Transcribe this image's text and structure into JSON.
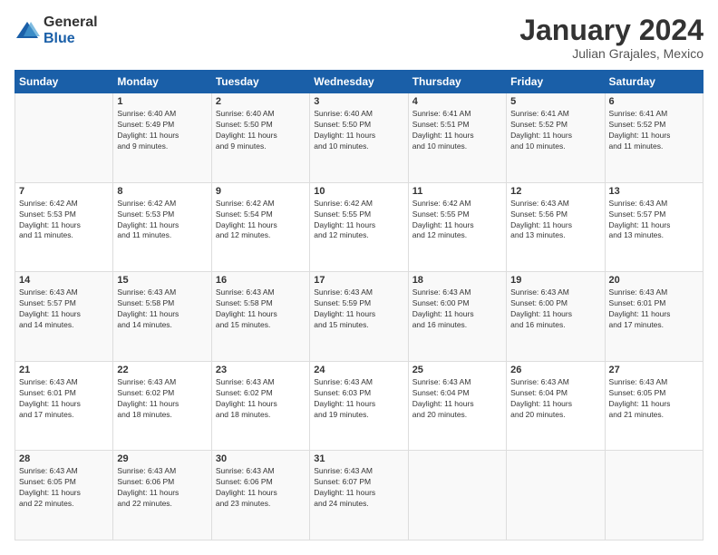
{
  "logo": {
    "general": "General",
    "blue": "Blue"
  },
  "title": "January 2024",
  "subtitle": "Julian Grajales, Mexico",
  "days_of_week": [
    "Sunday",
    "Monday",
    "Tuesday",
    "Wednesday",
    "Thursday",
    "Friday",
    "Saturday"
  ],
  "weeks": [
    [
      {
        "day": "",
        "info": ""
      },
      {
        "day": "1",
        "info": "Sunrise: 6:40 AM\nSunset: 5:49 PM\nDaylight: 11 hours\nand 9 minutes."
      },
      {
        "day": "2",
        "info": "Sunrise: 6:40 AM\nSunset: 5:50 PM\nDaylight: 11 hours\nand 9 minutes."
      },
      {
        "day": "3",
        "info": "Sunrise: 6:40 AM\nSunset: 5:50 PM\nDaylight: 11 hours\nand 10 minutes."
      },
      {
        "day": "4",
        "info": "Sunrise: 6:41 AM\nSunset: 5:51 PM\nDaylight: 11 hours\nand 10 minutes."
      },
      {
        "day": "5",
        "info": "Sunrise: 6:41 AM\nSunset: 5:52 PM\nDaylight: 11 hours\nand 10 minutes."
      },
      {
        "day": "6",
        "info": "Sunrise: 6:41 AM\nSunset: 5:52 PM\nDaylight: 11 hours\nand 11 minutes."
      }
    ],
    [
      {
        "day": "7",
        "info": "Sunrise: 6:42 AM\nSunset: 5:53 PM\nDaylight: 11 hours\nand 11 minutes."
      },
      {
        "day": "8",
        "info": "Sunrise: 6:42 AM\nSunset: 5:53 PM\nDaylight: 11 hours\nand 11 minutes."
      },
      {
        "day": "9",
        "info": "Sunrise: 6:42 AM\nSunset: 5:54 PM\nDaylight: 11 hours\nand 12 minutes."
      },
      {
        "day": "10",
        "info": "Sunrise: 6:42 AM\nSunset: 5:55 PM\nDaylight: 11 hours\nand 12 minutes."
      },
      {
        "day": "11",
        "info": "Sunrise: 6:42 AM\nSunset: 5:55 PM\nDaylight: 11 hours\nand 12 minutes."
      },
      {
        "day": "12",
        "info": "Sunrise: 6:43 AM\nSunset: 5:56 PM\nDaylight: 11 hours\nand 13 minutes."
      },
      {
        "day": "13",
        "info": "Sunrise: 6:43 AM\nSunset: 5:57 PM\nDaylight: 11 hours\nand 13 minutes."
      }
    ],
    [
      {
        "day": "14",
        "info": "Sunrise: 6:43 AM\nSunset: 5:57 PM\nDaylight: 11 hours\nand 14 minutes."
      },
      {
        "day": "15",
        "info": "Sunrise: 6:43 AM\nSunset: 5:58 PM\nDaylight: 11 hours\nand 14 minutes."
      },
      {
        "day": "16",
        "info": "Sunrise: 6:43 AM\nSunset: 5:58 PM\nDaylight: 11 hours\nand 15 minutes."
      },
      {
        "day": "17",
        "info": "Sunrise: 6:43 AM\nSunset: 5:59 PM\nDaylight: 11 hours\nand 15 minutes."
      },
      {
        "day": "18",
        "info": "Sunrise: 6:43 AM\nSunset: 6:00 PM\nDaylight: 11 hours\nand 16 minutes."
      },
      {
        "day": "19",
        "info": "Sunrise: 6:43 AM\nSunset: 6:00 PM\nDaylight: 11 hours\nand 16 minutes."
      },
      {
        "day": "20",
        "info": "Sunrise: 6:43 AM\nSunset: 6:01 PM\nDaylight: 11 hours\nand 17 minutes."
      }
    ],
    [
      {
        "day": "21",
        "info": "Sunrise: 6:43 AM\nSunset: 6:01 PM\nDaylight: 11 hours\nand 17 minutes."
      },
      {
        "day": "22",
        "info": "Sunrise: 6:43 AM\nSunset: 6:02 PM\nDaylight: 11 hours\nand 18 minutes."
      },
      {
        "day": "23",
        "info": "Sunrise: 6:43 AM\nSunset: 6:02 PM\nDaylight: 11 hours\nand 18 minutes."
      },
      {
        "day": "24",
        "info": "Sunrise: 6:43 AM\nSunset: 6:03 PM\nDaylight: 11 hours\nand 19 minutes."
      },
      {
        "day": "25",
        "info": "Sunrise: 6:43 AM\nSunset: 6:04 PM\nDaylight: 11 hours\nand 20 minutes."
      },
      {
        "day": "26",
        "info": "Sunrise: 6:43 AM\nSunset: 6:04 PM\nDaylight: 11 hours\nand 20 minutes."
      },
      {
        "day": "27",
        "info": "Sunrise: 6:43 AM\nSunset: 6:05 PM\nDaylight: 11 hours\nand 21 minutes."
      }
    ],
    [
      {
        "day": "28",
        "info": "Sunrise: 6:43 AM\nSunset: 6:05 PM\nDaylight: 11 hours\nand 22 minutes."
      },
      {
        "day": "29",
        "info": "Sunrise: 6:43 AM\nSunset: 6:06 PM\nDaylight: 11 hours\nand 22 minutes."
      },
      {
        "day": "30",
        "info": "Sunrise: 6:43 AM\nSunset: 6:06 PM\nDaylight: 11 hours\nand 23 minutes."
      },
      {
        "day": "31",
        "info": "Sunrise: 6:43 AM\nSunset: 6:07 PM\nDaylight: 11 hours\nand 24 minutes."
      },
      {
        "day": "",
        "info": ""
      },
      {
        "day": "",
        "info": ""
      },
      {
        "day": "",
        "info": ""
      }
    ]
  ]
}
